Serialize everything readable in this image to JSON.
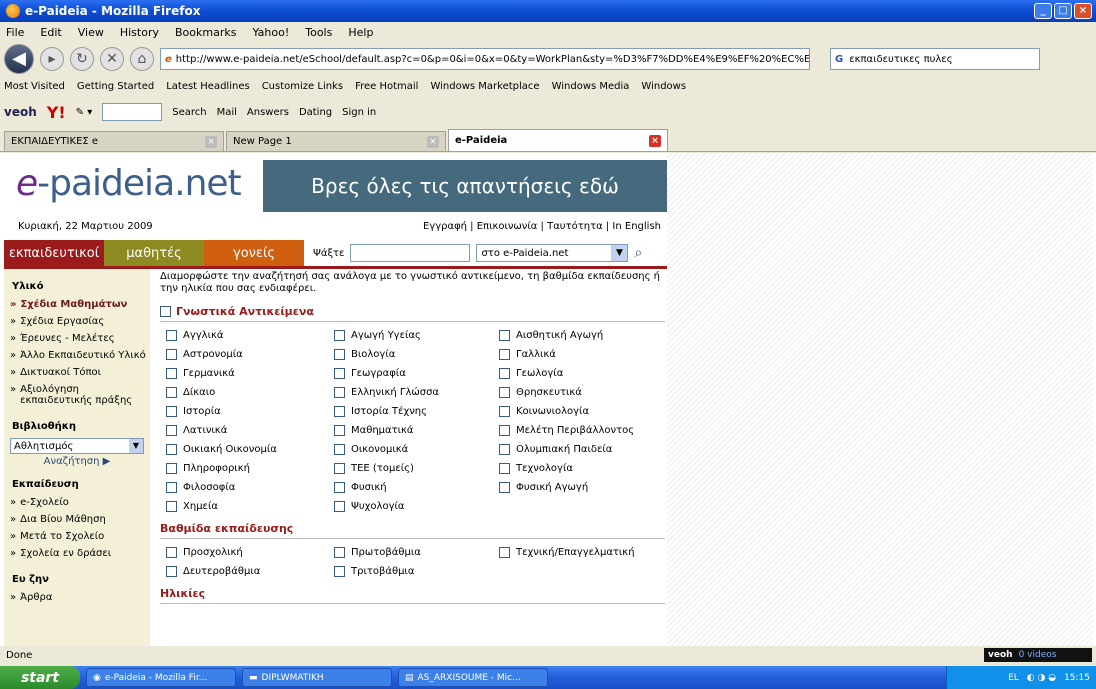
{
  "window": {
    "title": "e-Paideia - Mozilla Firefox"
  },
  "menu": [
    "File",
    "Edit",
    "View",
    "History",
    "Bookmarks",
    "Yahoo!",
    "Tools",
    "Help"
  ],
  "nav": {
    "url": "http://www.e-paideia.net/eSchool/default.asp?c=0&p=0&i=0&x=0&ty=WorkPlan&sty=%D3%F7%DD%E4%E9%EF%20%EC%E1%E8%DE%E",
    "search_engine": "G",
    "search_value": "εκπαιδευτικες πυλες"
  },
  "bookmarks": [
    "Most Visited",
    "Getting Started",
    "Latest Headlines",
    "Customize Links",
    "Free Hotmail",
    "Windows Marketplace",
    "Windows Media",
    "Windows"
  ],
  "toolbar": {
    "veoh": "veoh",
    "yahoo": "Y!",
    "search": "Search",
    "mail": "Mail",
    "answers": "Answers",
    "dating": "Dating",
    "signin": "Sign in"
  },
  "tabs": [
    {
      "label": "ΕΚΠΑΙΔΕΥΤΙΚΕΣ e"
    },
    {
      "label": "New Page 1"
    },
    {
      "label": "e-Paideia"
    }
  ],
  "page": {
    "logo_e": "e",
    "logo_rest": "-paideia.net",
    "banner": "Βρες όλες τις απαντήσεις εδώ",
    "date": "Κυριακή, 22 Μαρτιου 2009",
    "toplinks": "Εγγραφή | Επικοινωνία | Ταυτότητα | In English",
    "roles": [
      {
        "label": "εκπαιδευτικοί",
        "color": "#9b1b1b"
      },
      {
        "label": "μαθητές",
        "color": "#8c8a20"
      },
      {
        "label": "γονείς",
        "color": "#d06010"
      }
    ],
    "search_label": "Ψάξτε",
    "search_scope": "στο e-Paideia.net",
    "sidebar": {
      "material_title": "Υλικό",
      "material_items": [
        "Σχέδια Μαθημάτων",
        "Σχέδια Εργασίας",
        "Έρευνες - Μελέτες",
        "Άλλο Εκπαιδευτικό Υλικό",
        "Δικτυακοί Τόποι",
        "Αξιολόγηση εκπαιδευτικής πράξης"
      ],
      "library_title": "Βιβλιοθήκη",
      "library_select": "Αθλητισμός",
      "library_search": "Αναζήτηση ▶",
      "education_title": "Εκπαίδευση",
      "education_items": [
        "e-Σχολείο",
        "Δια Βίου Μάθηση",
        "Μετά το Σχολείο",
        "Σχολεία εν δράσει"
      ],
      "living_title": "Ευ ζην",
      "living_items": [
        "Άρθρα"
      ]
    },
    "intro": "Διαμορφώστε την αναζήτησή σας ανάλογα με το γνωστικό αντικείμενο, τη βαθμίδα εκπαίδευσης ή την ηλικία που σας ενδιαφέρει.",
    "subjects_title": "Γνωστικά Αντικείμενα",
    "subjects": [
      "Αγγλικά",
      "Αγωγή Υγείας",
      "Αισθητική Αγωγή",
      "Αστρονομία",
      "Βιολογία",
      "Γαλλικά",
      "Γερμανικά",
      "Γεωγραφία",
      "Γεωλογία",
      "Δίκαιο",
      "Ελληνική Γλώσσα",
      "Θρησκευτικά",
      "Ιστορία",
      "Ιστορία Τέχνης",
      "Κοινωνιολογία",
      "Λατινικά",
      "Μαθηματικά",
      "Μελέτη Περιβάλλοντος",
      "Οικιακή Οικονομία",
      "Οικονομικά",
      "Ολυμπιακή Παιδεία",
      "Πληροφορική",
      "ΤΕΕ (τομείς)",
      "Τεχνολογία",
      "Φιλοσοφία",
      "Φυσική",
      "Φυσική Αγωγή",
      "Χημεία",
      "Ψυχολογία"
    ],
    "levels_title": "Βαθμίδα εκπαίδευσης",
    "levels": [
      "Προσχολική",
      "Πρωτοβάθμια",
      "Τεχνική/Επαγγελματική",
      "Δευτεροβάθμια",
      "Τριτοβάθμια"
    ],
    "ages_title": "Ηλικίες"
  },
  "status": {
    "text": "Done",
    "veoh": "veoh",
    "veoh_videos": "0 videos"
  },
  "taskbar": {
    "start": "start",
    "items": [
      "e-Paideia - Mozilla Fir...",
      "DIPLWMATIKH",
      "AS_ARXISOUME - Mic..."
    ],
    "lang": "EL",
    "clock": "15:15"
  }
}
